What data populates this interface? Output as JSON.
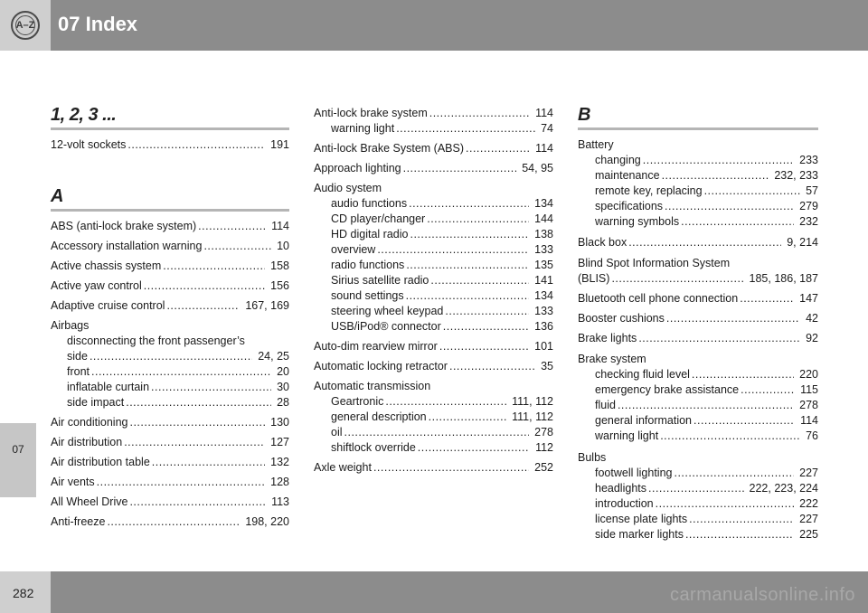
{
  "header": {
    "title": "07 Index",
    "icon": "a-z-icon",
    "icon_text": "A–Z"
  },
  "side_tab": {
    "label": "07"
  },
  "footer": {
    "page_number": "282",
    "watermark": "carmanualsonline.info"
  },
  "sections": {
    "s123": {
      "heading": "1, 2, 3 ..."
    },
    "a": {
      "heading": "A"
    },
    "b": {
      "heading": "B"
    }
  },
  "entries": {
    "e01": {
      "t": "12-volt sockets",
      "p": "191"
    },
    "e02": {
      "t": "ABS (anti-lock brake system)",
      "p": "114"
    },
    "e03": {
      "t": "Accessory installation warning",
      "p": "10"
    },
    "e04": {
      "t": "Active chassis system",
      "p": "158"
    },
    "e05": {
      "t": "Active yaw control",
      "p": "156"
    },
    "e06": {
      "t": "Adaptive cruise control",
      "p": "167, 169"
    },
    "e07": {
      "t": "Airbags"
    },
    "e08": {
      "t": "disconnecting the front passenger’s"
    },
    "e09": {
      "t": "side",
      "p": "24, 25"
    },
    "e10": {
      "t": "front",
      "p": "20"
    },
    "e11": {
      "t": "inflatable curtain",
      "p": "30"
    },
    "e12": {
      "t": "side impact",
      "p": "28"
    },
    "e13": {
      "t": "Air conditioning",
      "p": "130"
    },
    "e14": {
      "t": "Air distribution",
      "p": "127"
    },
    "e15": {
      "t": "Air distribution table",
      "p": "132"
    },
    "e16": {
      "t": "Air vents",
      "p": "128"
    },
    "e17": {
      "t": "All Wheel Drive",
      "p": "113"
    },
    "e18": {
      "t": "Anti-freeze",
      "p": "198, 220"
    },
    "f01": {
      "t": "Anti-lock brake system",
      "p": "114"
    },
    "f02": {
      "t": "warning light",
      "p": "74"
    },
    "f03": {
      "t": "Anti-lock Brake System (ABS)",
      "p": "114"
    },
    "f04": {
      "t": "Approach lighting",
      "p": "54, 95"
    },
    "f05": {
      "t": "Audio system"
    },
    "f06": {
      "t": "audio functions",
      "p": "134"
    },
    "f07": {
      "t": "CD player/changer",
      "p": "144"
    },
    "f08": {
      "t": "HD digital radio",
      "p": "138"
    },
    "f09": {
      "t": "overview",
      "p": "133"
    },
    "f10": {
      "t": "radio functions",
      "p": "135"
    },
    "f11": {
      "t": "Sirius satellite radio",
      "p": "141"
    },
    "f12": {
      "t": "sound settings",
      "p": "134"
    },
    "f13": {
      "t": "steering wheel keypad",
      "p": "133"
    },
    "f14": {
      "t": "USB/iPod® connector",
      "p": "136"
    },
    "f15": {
      "t": "Auto-dim rearview mirror",
      "p": "101"
    },
    "f16": {
      "t": "Automatic locking retractor",
      "p": "35"
    },
    "f17": {
      "t": "Automatic transmission"
    },
    "f18": {
      "t": "Geartronic",
      "p": "111, 112"
    },
    "f19": {
      "t": "general description",
      "p": "111, 112"
    },
    "f20": {
      "t": "oil",
      "p": "278"
    },
    "f21": {
      "t": "shiftlock override",
      "p": "112"
    },
    "f22": {
      "t": "Axle weight",
      "p": "252"
    },
    "g01": {
      "t": "Battery"
    },
    "g02": {
      "t": "changing",
      "p": "233"
    },
    "g03": {
      "t": "maintenance",
      "p": "232, 233"
    },
    "g04": {
      "t": "remote key, replacing",
      "p": "57"
    },
    "g05": {
      "t": "specifications",
      "p": "279"
    },
    "g06": {
      "t": "warning symbols",
      "p": "232"
    },
    "g07": {
      "t": "Black box",
      "p": "9, 214"
    },
    "g08": {
      "t": "Blind Spot Information System"
    },
    "g09": {
      "t": "(BLIS)",
      "p": "185, 186, 187"
    },
    "g10": {
      "t": "Bluetooth cell phone connection",
      "p": "147"
    },
    "g11": {
      "t": "Booster cushions",
      "p": "42"
    },
    "g12": {
      "t": "Brake lights",
      "p": "92"
    },
    "g13": {
      "t": "Brake system"
    },
    "g14": {
      "t": "checking fluid level",
      "p": "220"
    },
    "g15": {
      "t": "emergency brake assistance",
      "p": "115"
    },
    "g16": {
      "t": "fluid",
      "p": "278"
    },
    "g17": {
      "t": "general information",
      "p": "114"
    },
    "g18": {
      "t": "warning light",
      "p": "76"
    },
    "g19": {
      "t": "Bulbs"
    },
    "g20": {
      "t": "footwell lighting",
      "p": "227"
    },
    "g21": {
      "t": "headlights",
      "p": "222, 223, 224"
    },
    "g22": {
      "t": "introduction",
      "p": "222"
    },
    "g23": {
      "t": "license plate lights",
      "p": "227"
    },
    "g24": {
      "t": "side marker lights",
      "p": "225"
    }
  }
}
